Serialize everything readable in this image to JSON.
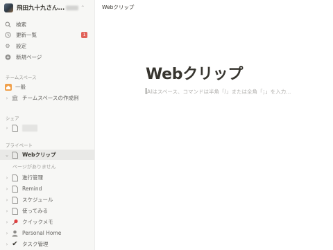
{
  "workspace": {
    "name": "飛田九十九さん...",
    "chevron": "⌃"
  },
  "menu": {
    "search": "検索",
    "updates": "更新一覧",
    "updates_badge": "1",
    "settings": "設定",
    "new_page": "新規ページ"
  },
  "sections": {
    "teamspace": "チームスペース",
    "shared": "シェア",
    "private": "プライベート"
  },
  "teamspace_items": [
    "一般",
    "チームスペースの作成例"
  ],
  "private_items": {
    "active": "Webクリップ",
    "empty_note": "ページがありません",
    "items": [
      "進行管理",
      "Remind",
      "スケジュール",
      "使ってみる",
      "クイックメモ",
      "Personal Home",
      "タスク管理"
    ]
  },
  "topbar": {
    "breadcrumb": "Webクリップ"
  },
  "page": {
    "title": "Webクリップ",
    "placeholder": "AIはスペース、コマンドは半角「/」または全角「；」を入力..."
  },
  "colors": {
    "sidebar_bg": "#f7f7f5",
    "badge": "#e16259",
    "active_bg": "#e9e9e7"
  },
  "icons": [
    "search-icon",
    "clock-icon",
    "gear-icon",
    "plus-circle-icon",
    "home-icon",
    "building-icon",
    "page-icon",
    "pin-icon",
    "person-icon",
    "check-icon",
    "chevron-right-icon",
    "chevron-down-icon"
  ]
}
